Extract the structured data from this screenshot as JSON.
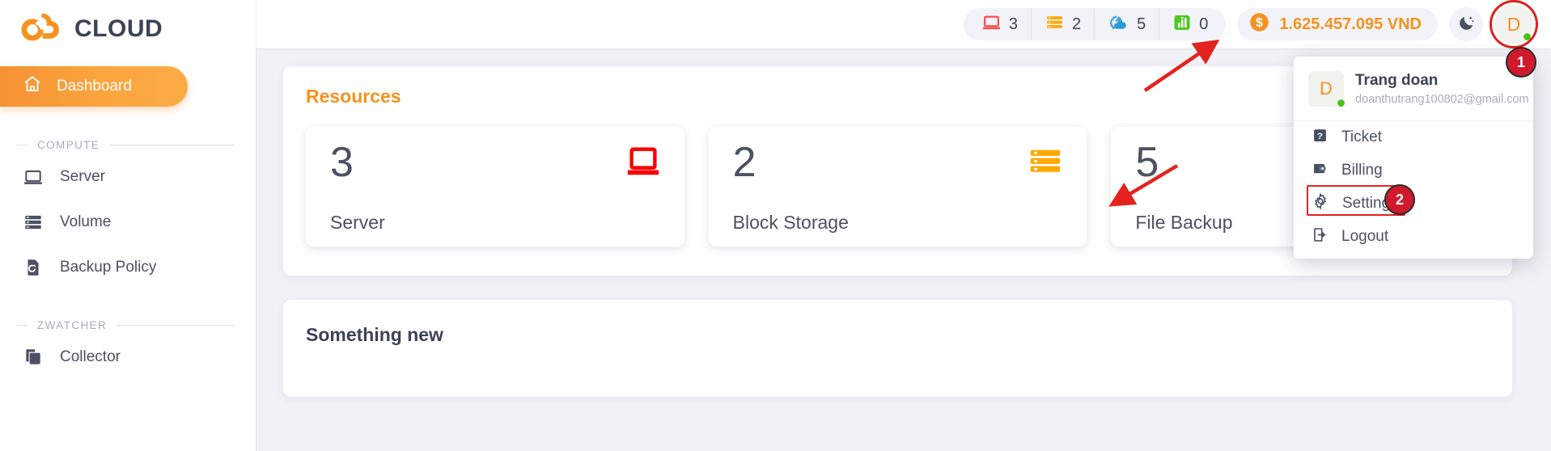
{
  "brand": {
    "name": "CLOUD",
    "logo_icon": "cloud-logo-icon"
  },
  "sidebar": {
    "active_item": {
      "label": "Dashboard",
      "icon": "home-icon"
    },
    "sections": [
      {
        "title": "COMPUTE",
        "items": [
          {
            "label": "Server",
            "icon": "laptop-icon"
          },
          {
            "label": "Volume",
            "icon": "storage-icon"
          },
          {
            "label": "Backup Policy",
            "icon": "backup-restore-icon"
          }
        ]
      },
      {
        "title": "ZWATCHER",
        "items": [
          {
            "label": "Collector",
            "icon": "copy-layers-icon"
          }
        ]
      }
    ]
  },
  "topbar": {
    "stats": [
      {
        "icon": "laptop-icon",
        "value": "3",
        "color": "#fb4b4b"
      },
      {
        "icon": "block-storage-icon",
        "value": "2",
        "color": "#ffa800"
      },
      {
        "icon": "cloud-backup-icon",
        "value": "5",
        "color": "#2e9ad4"
      },
      {
        "icon": "bar-chart-icon",
        "value": "0",
        "color": "#4ec820"
      }
    ],
    "balance": {
      "icon": "dollar-coin-icon",
      "value": "1.625.457.095 VND",
      "color": "#f5921e"
    },
    "dark_mode_icon": "moon-stars-icon",
    "avatar": {
      "initial": "D",
      "status": "online"
    }
  },
  "user_menu": {
    "avatar_initial": "D",
    "name": "Trang doan",
    "email": "doanthutrang100802@gmail.com",
    "items": [
      {
        "label": "Ticket",
        "icon": "question-mark-icon",
        "highlighted": false
      },
      {
        "label": "Billing",
        "icon": "wallet-icon",
        "highlighted": false
      },
      {
        "label": "Settings",
        "icon": "gear-icon",
        "highlighted": true
      },
      {
        "label": "Logout",
        "icon": "logout-arrow-icon",
        "highlighted": false
      }
    ]
  },
  "main": {
    "resources": {
      "title": "Resources",
      "cards": [
        {
          "value": "3",
          "label": "Server",
          "icon": "laptop-icon",
          "color": "#fb0000"
        },
        {
          "value": "2",
          "label": "Block Storage",
          "icon": "block-storage-icon",
          "color": "#ffa800"
        },
        {
          "value": "5",
          "label": "File Backup",
          "icon": "cloud-backup-icon",
          "color": "#2fa8a0"
        }
      ]
    },
    "news": {
      "title": "Something new"
    }
  },
  "annotations": {
    "step1": "1",
    "step2": "2"
  }
}
